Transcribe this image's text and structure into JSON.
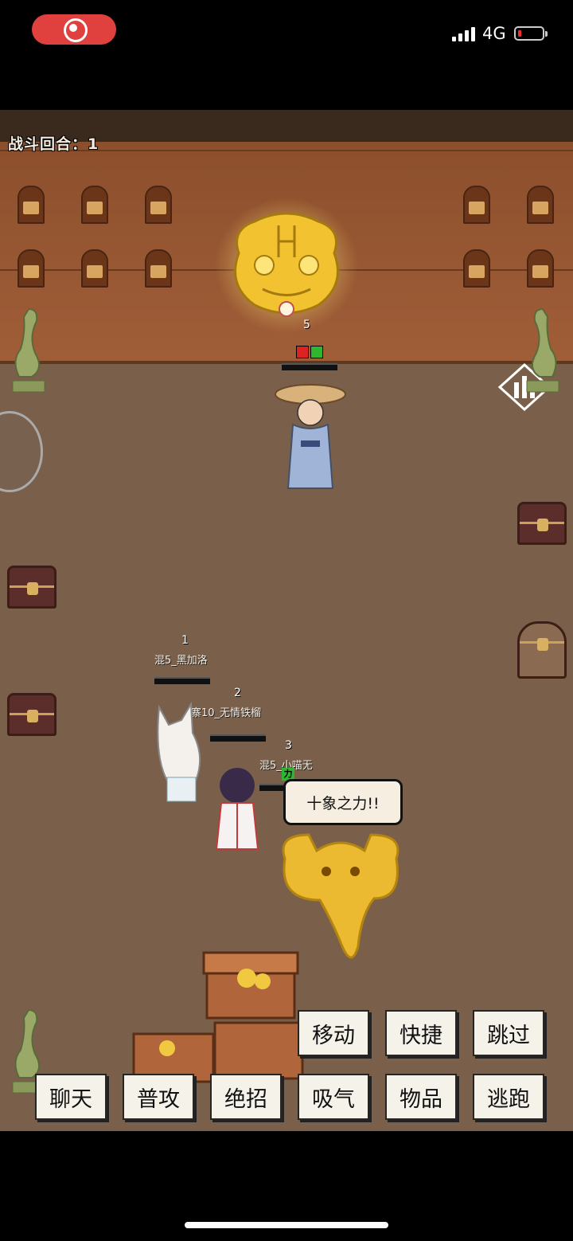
{
  "status_bar": {
    "network": "4G",
    "battery_level": 0.08,
    "recording_indicator": "record-icon"
  },
  "battle": {
    "round_label": "战斗回合：1",
    "enemy": {
      "index": "5",
      "name": ""
    },
    "allies": [
      {
        "index": "1",
        "name": "混5_黑加洛"
      },
      {
        "index": "2",
        "name": "寨10_无情铁榴"
      },
      {
        "index": "3",
        "name": "混5_小喵无"
      }
    ],
    "buff_label": "力",
    "speech": "十象之力!!"
  },
  "actions": {
    "move": "移动",
    "quick": "快捷",
    "skip": "跳过",
    "chat": "聊天",
    "attack": "普攻",
    "ultimate": "绝招",
    "breathe": "吸气",
    "items": "物品",
    "flee": "逃跑"
  },
  "icons": {
    "stats_icon": "bar-chart-icon",
    "avatar": "avatar-icon"
  },
  "colors": {
    "wall": "#9a5834",
    "floor": "#7a604a",
    "record": "#e0403e",
    "buff": "#2fb52f"
  }
}
